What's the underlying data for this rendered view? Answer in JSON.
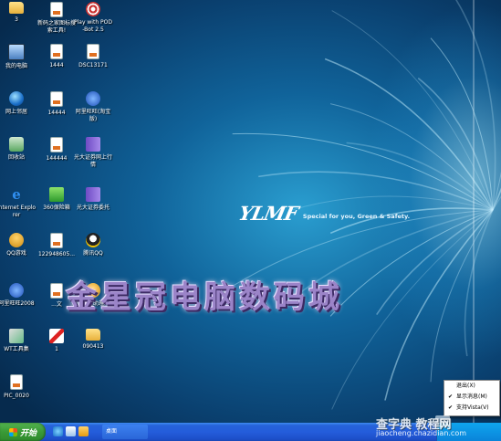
{
  "desktop": {
    "icons": [
      {
        "label": "3",
        "icon": "folder-icon",
        "glyph": "g-folder"
      },
      {
        "label": "新码之家图标搜索工具!",
        "icon": "document-icon",
        "glyph": "g-doc"
      },
      {
        "label": "Play with POD-Bot 2.5",
        "icon": "game-icon",
        "glyph": "g-target"
      },
      {
        "label": "我的电脑",
        "icon": "my-computer-icon",
        "glyph": "g-pc"
      },
      {
        "label": "1444",
        "icon": "image-file-icon",
        "glyph": "g-doc"
      },
      {
        "label": "DSC13171",
        "icon": "photo-file-icon",
        "glyph": "g-doc"
      },
      {
        "label": "网上邻居",
        "icon": "network-icon",
        "glyph": "g-globe"
      },
      {
        "label": "14444",
        "icon": "image-file-icon",
        "glyph": "g-doc"
      },
      {
        "label": "阿里旺旺(淘宝版)",
        "icon": "aliwangwang-icon",
        "glyph": "g-ie2"
      },
      {
        "label": "回收站",
        "icon": "recycle-bin-icon",
        "glyph": "g-recycle"
      },
      {
        "label": "144444",
        "icon": "image-file-icon",
        "glyph": "g-doc"
      },
      {
        "label": "光大证券网上行情",
        "icon": "stock-app-icon",
        "glyph": "g-book"
      },
      {
        "label": "Internet Explorer",
        "icon": "internet-explorer-icon",
        "glyph": "g-ie"
      },
      {
        "label": "360保险箱",
        "icon": "360-safe-icon",
        "glyph": "g-green"
      },
      {
        "label": "光大证券委托",
        "icon": "stock-trade-icon",
        "glyph": "g-book"
      },
      {
        "label": "QQ游戏",
        "icon": "qq-game-icon",
        "glyph": "g-person"
      },
      {
        "label": "122948605...",
        "icon": "image-file-icon",
        "glyph": "g-doc"
      },
      {
        "label": "腾讯QQ",
        "icon": "qq-icon",
        "glyph": "g-qq"
      },
      {
        "label": "阿里旺旺2008",
        "icon": "aliwangwang-2008-icon",
        "glyph": "g-ie2"
      },
      {
        "label": "...文",
        "icon": "text-file-icon",
        "glyph": "g-doc"
      },
      {
        "label": "淘宝助理",
        "icon": "taobao-assistant-icon",
        "glyph": "g-person"
      },
      {
        "label": "WT工具集",
        "icon": "toolbox-icon",
        "glyph": "g-tool"
      },
      {
        "label": "1",
        "icon": "pen-file-icon",
        "glyph": "g-pen"
      },
      {
        "label": "090413",
        "icon": "folder-icon",
        "glyph": "g-folder"
      },
      {
        "label": "PIC_0020",
        "icon": "image-file-icon",
        "glyph": "g-doc"
      }
    ]
  },
  "wallpaper": {
    "logo_mark": "YLMF",
    "logo_tagline": "Special for you, Green & Safety."
  },
  "watermark": "金星冠电脑数码城",
  "context_menu": {
    "items": [
      {
        "label": "退出(X)",
        "checked": false
      },
      {
        "label": "显示消息(M)",
        "checked": true
      },
      {
        "label": "支持Vista(V)",
        "checked": true
      }
    ]
  },
  "taskbar": {
    "start_label": "开始",
    "task_button_label": "桌面"
  },
  "site_watermark": {
    "brand": "查字典 教程网",
    "url": "jiaocheng.chazidian.com"
  },
  "colors": {
    "taskbar_blue": "#245ddb",
    "start_green": "#3a9a37",
    "tray_blue": "#0a84d9"
  }
}
